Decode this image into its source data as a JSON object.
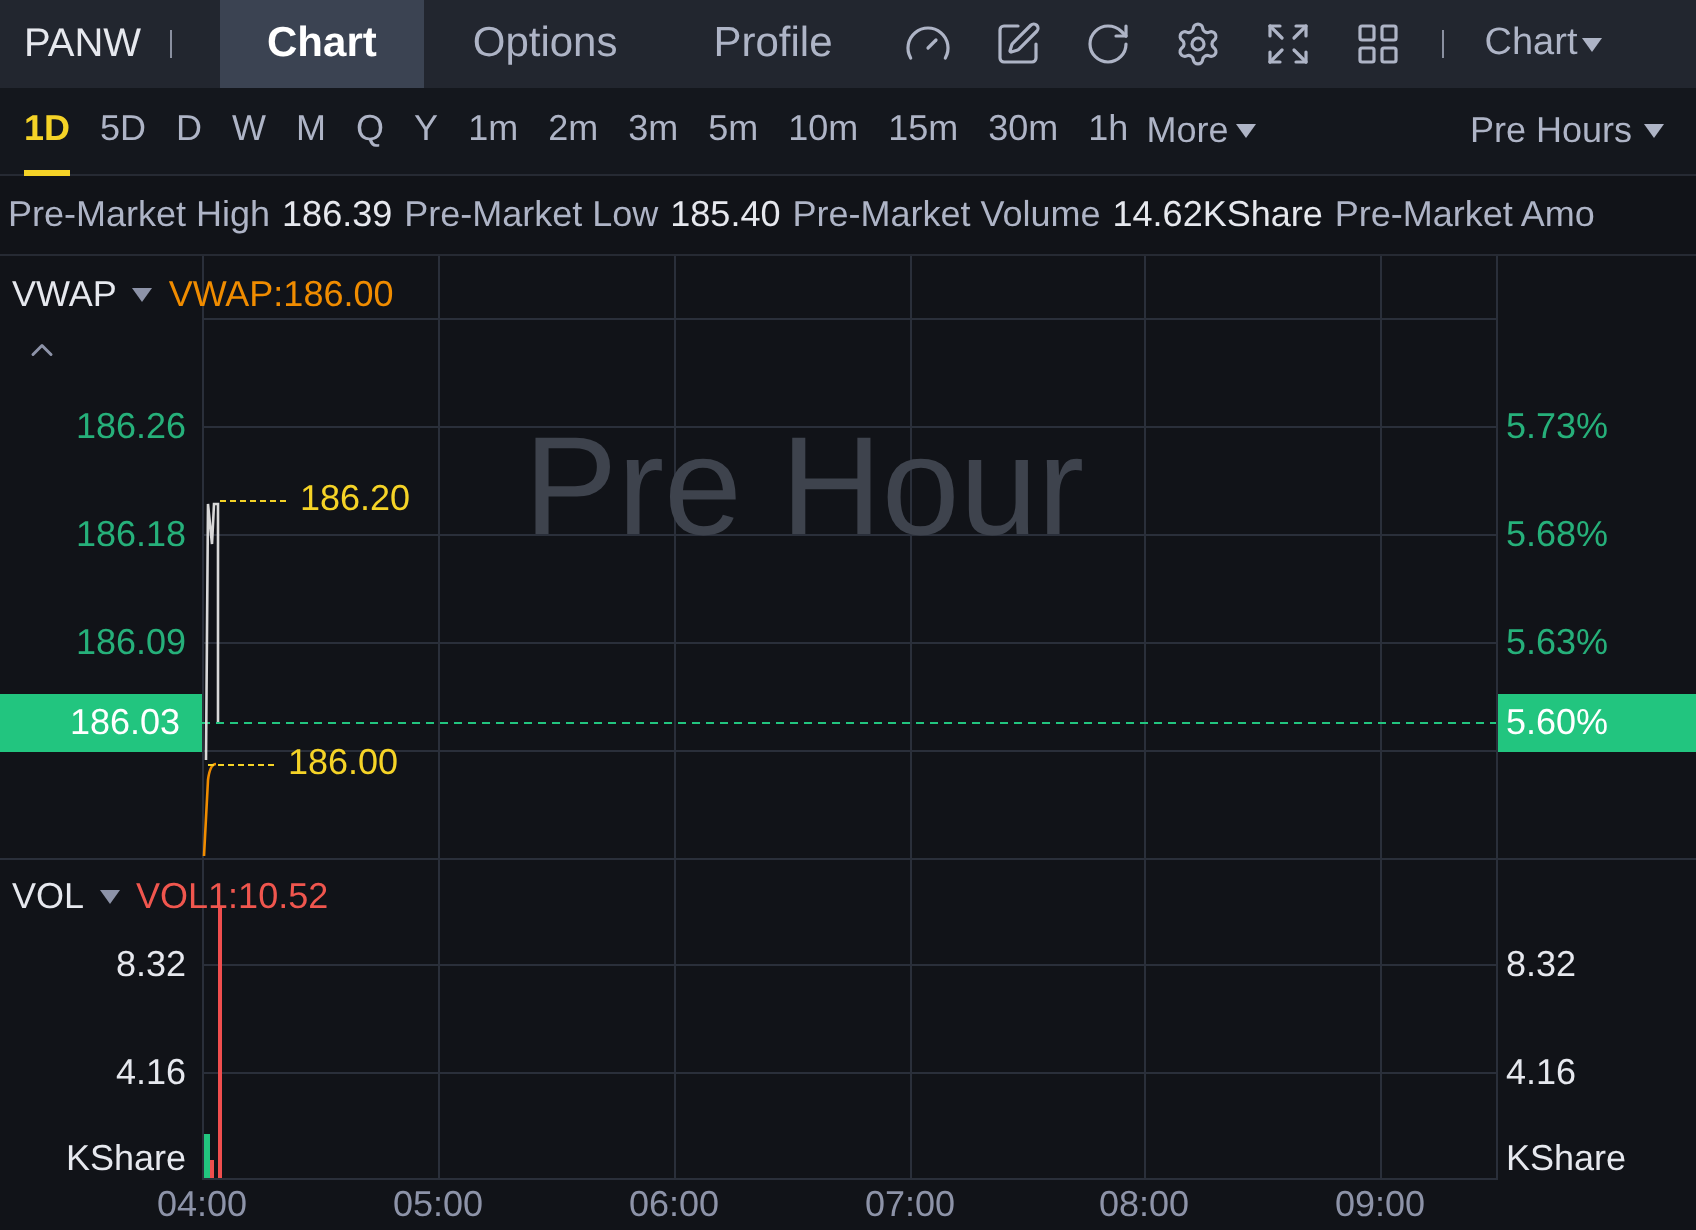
{
  "symbol": "PANW",
  "tabs": [
    {
      "label": "Chart",
      "selected": true
    },
    {
      "label": "Options",
      "selected": false
    },
    {
      "label": "Profile",
      "selected": false
    }
  ],
  "view_menu": "Chart",
  "periods": [
    {
      "label": "1D",
      "selected": true
    },
    {
      "label": "5D",
      "selected": false
    },
    {
      "label": "D",
      "selected": false
    },
    {
      "label": "W",
      "selected": false
    },
    {
      "label": "M",
      "selected": false
    },
    {
      "label": "Q",
      "selected": false
    },
    {
      "label": "Y",
      "selected": false
    },
    {
      "label": "1m",
      "selected": false
    },
    {
      "label": "2m",
      "selected": false
    },
    {
      "label": "3m",
      "selected": false
    },
    {
      "label": "5m",
      "selected": false
    },
    {
      "label": "10m",
      "selected": false
    },
    {
      "label": "15m",
      "selected": false
    },
    {
      "label": "30m",
      "selected": false
    },
    {
      "label": "1h",
      "selected": false
    }
  ],
  "more": "More",
  "session": "Pre Hours",
  "stats": [
    {
      "label": "Pre-Market High",
      "value": "186.39"
    },
    {
      "label": "Pre-Market Low",
      "value": "185.40"
    },
    {
      "label": "Pre-Market Volume",
      "value": "14.62KShare"
    },
    {
      "label": "Pre-Market Amo"
    }
  ],
  "price_pane": {
    "indicator": "VWAP",
    "indicator_value": "VWAP:186.00",
    "watermark": "Pre Hour",
    "left_axis": [
      "186.26",
      "186.18",
      "186.09"
    ],
    "right_axis": [
      "5.73%",
      "5.68%",
      "5.63%"
    ],
    "current_price": "186.03",
    "current_change": "5.60%",
    "high_marker": "186.20",
    "low_marker": "186.00"
  },
  "volume_pane": {
    "indicator": "VOL",
    "indicator_value": "VOL1:10.52",
    "left_axis": [
      "8.32",
      "4.16"
    ],
    "right_axis": [
      "8.32",
      "4.16"
    ],
    "unit_left": "KShare",
    "unit_right": "KShare"
  },
  "time_axis": [
    "04:00",
    "05:00",
    "06:00",
    "07:00",
    "08:00",
    "09:00"
  ]
}
